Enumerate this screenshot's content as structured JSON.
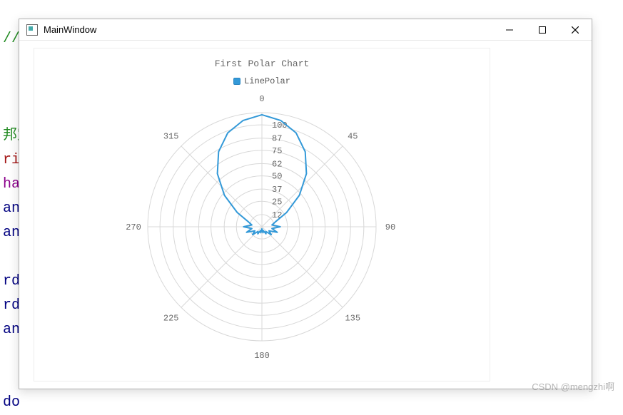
{
  "background": {
    "line1": "//把点存进去",
    "frag_cn": "邦定",
    "frag_rid": "rid",
    "frag_har1": "har",
    "frag_an1": "an",
    "frag_an2": "an",
    "frag_rdo1": "rdo",
    "frag_rdo2": "rdo",
    "frag_an3": "an",
    "frag_do": "do"
  },
  "window": {
    "title": "MainWindow"
  },
  "watermark": "CSDN @mengzhi啊",
  "chart_data": {
    "type": "polar-line",
    "title": "First Polar Chart",
    "legend": [
      "LinePolar"
    ],
    "angular_ticks": [
      0,
      45,
      90,
      135,
      180,
      225,
      270,
      315
    ],
    "radial_ticks": [
      12,
      25,
      37,
      50,
      62,
      75,
      87,
      100
    ],
    "radial_max": 112,
    "series": [
      {
        "name": "LinePolar",
        "color": "#3399d8",
        "points": [
          {
            "angle": 0,
            "r": 110
          },
          {
            "angle": 10,
            "r": 106
          },
          {
            "angle": 20,
            "r": 98
          },
          {
            "angle": 30,
            "r": 85
          },
          {
            "angle": 40,
            "r": 68
          },
          {
            "angle": 50,
            "r": 48
          },
          {
            "angle": 60,
            "r": 28
          },
          {
            "angle": 70,
            "r": 14
          },
          {
            "angle": 80,
            "r": 10
          },
          {
            "angle": 90,
            "r": 18
          },
          {
            "angle": 100,
            "r": 10
          },
          {
            "angle": 110,
            "r": 16
          },
          {
            "angle": 120,
            "r": 8
          },
          {
            "angle": 130,
            "r": 12
          },
          {
            "angle": 140,
            "r": 6
          },
          {
            "angle": 150,
            "r": 8
          },
          {
            "angle": 160,
            "r": 4
          },
          {
            "angle": 170,
            "r": 6
          },
          {
            "angle": 180,
            "r": 2
          },
          {
            "angle": 190,
            "r": 6
          },
          {
            "angle": 200,
            "r": 4
          },
          {
            "angle": 210,
            "r": 8
          },
          {
            "angle": 220,
            "r": 6
          },
          {
            "angle": 230,
            "r": 12
          },
          {
            "angle": 240,
            "r": 8
          },
          {
            "angle": 250,
            "r": 16
          },
          {
            "angle": 260,
            "r": 10
          },
          {
            "angle": 270,
            "r": 18
          },
          {
            "angle": 280,
            "r": 10
          },
          {
            "angle": 290,
            "r": 14
          },
          {
            "angle": 300,
            "r": 28
          },
          {
            "angle": 310,
            "r": 48
          },
          {
            "angle": 320,
            "r": 68
          },
          {
            "angle": 330,
            "r": 85
          },
          {
            "angle": 340,
            "r": 98
          },
          {
            "angle": 350,
            "r": 106
          }
        ]
      }
    ]
  }
}
